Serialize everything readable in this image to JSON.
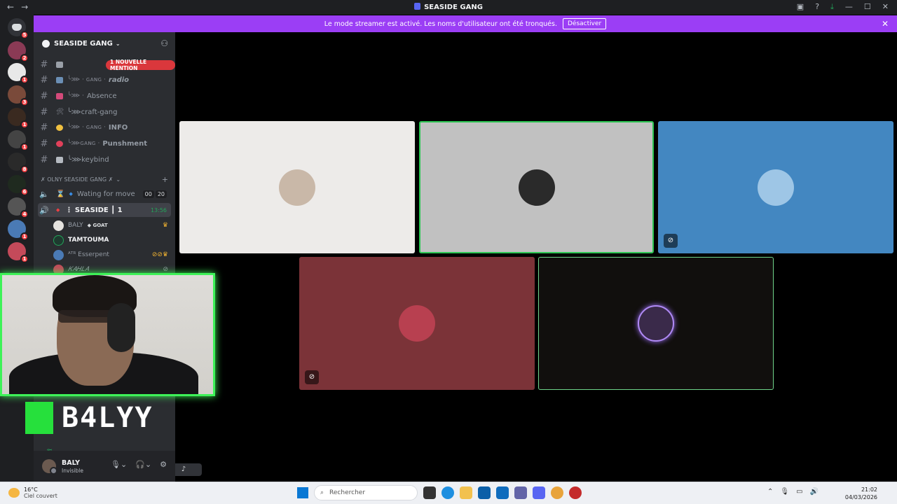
{
  "window": {
    "title": "SEASIDE GANG",
    "back": "←",
    "forward": "→"
  },
  "banner": {
    "message": "Le mode streamer est activé. Les noms d'utilisateur ont été tronqués.",
    "button": "Désactiver",
    "close": "✕"
  },
  "guilds": {
    "badges": [
      "5",
      "2",
      "1",
      "3",
      "1",
      "1",
      "8",
      "6",
      "4",
      "1",
      "1"
    ]
  },
  "server": {
    "name": "SEASIDE GANG",
    "chevron": "⌄"
  },
  "channels": [
    {
      "deco": "",
      "label": ""
    },
    {
      "deco": "╰⋙ · ɢᴀɴɢ ·",
      "label": "radio"
    },
    {
      "deco": "╰⋙ ·",
      "label": "Absence"
    },
    {
      "deco": "🛠",
      "label": "╰⋙craft-gang"
    },
    {
      "deco": "╰⋙ · ɢᴀɴɢ ·",
      "label": "INFO"
    },
    {
      "deco": "╰⋙ɢᴀɴɢ ·",
      "label": "Punshment"
    },
    {
      "deco": "",
      "label": "╰⋙keybind"
    }
  ],
  "mention_badge": "1 NOUVELLE MENTION",
  "category": {
    "name": "✗ OLNY SEASIDE GANG ✗",
    "chevron": "⌄",
    "plus": "+"
  },
  "voice_channels": [
    {
      "label": "Wating for move",
      "count_a": "00",
      "count_b": "20"
    },
    {
      "label": "⋮ SEASIDE ┃ 1",
      "time": "13:56"
    }
  ],
  "members": [
    {
      "name": "BALY",
      "tag": "GOAT"
    },
    {
      "name": "TAMTOUMA"
    },
    {
      "name": "ᴬᵀᴿ Esserpent"
    },
    {
      "name": "𝐾𝐴𝐻𝐿𝐴"
    }
  ],
  "overlay": {
    "logo_text": "B4LYY"
  },
  "user": {
    "name": "BALY",
    "status": "Invisible"
  },
  "taskbar": {
    "temp": "16°C",
    "condition": "Ciel couvert",
    "search": "Rechercher",
    "time": "21:02",
    "date": "04/03/2026"
  },
  "colors": {
    "banner": "#9b3ef5",
    "speaking": "#2dc653",
    "mention": "#da373c",
    "webcam_glow": "#3ef258"
  }
}
